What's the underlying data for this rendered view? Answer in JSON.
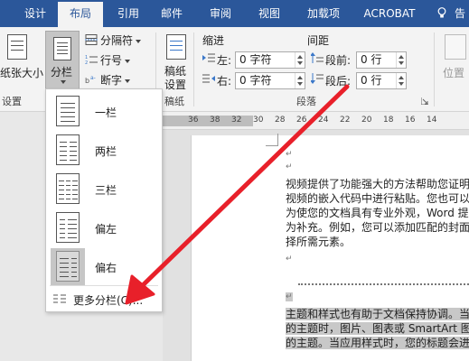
{
  "tabs": [
    "设计",
    "布局",
    "引用",
    "邮件",
    "审阅",
    "视图",
    "加载项",
    "ACROBAT",
    "告"
  ],
  "active_tab_index": 1,
  "ribbon": {
    "paper_size_label": "纸张大小",
    "columns_label": "分栏",
    "breaks_label": "分隔符",
    "line_numbers_label": "行号",
    "hyphenation_label": "断字",
    "setup_group_label": "设置",
    "draft_paper_label1": "稿纸",
    "draft_paper_label2": "设置",
    "draft_group_label": "稿纸",
    "indent_header": "缩进",
    "spacing_header": "间距",
    "indent_left_label": "左:",
    "indent_right_label": "右:",
    "indent_left_value": "0 字符",
    "indent_right_value": "0 字符",
    "spacing_before_label": "段前:",
    "spacing_after_label": "段后:",
    "spacing_before_value": "0 行",
    "spacing_after_value": "0 行",
    "paragraph_group_label": "段落",
    "position_label": "位置"
  },
  "ruler_numbers": [
    "36",
    "38",
    "32",
    "30",
    "28",
    "26",
    "24",
    "22",
    "20",
    "18",
    "16",
    "14"
  ],
  "columns_menu": {
    "items": [
      "一栏",
      "两栏",
      "三栏",
      "偏左",
      "偏右"
    ],
    "selected_index": 4,
    "more_label": "更多分栏(C)..."
  },
  "document": {
    "para1": [
      "视频提供了功能强大的方法帮助您证明",
      "视频的嵌入代码中进行粘贴。您也可以",
      "为使您的文档具有专业外观，Word 提",
      "为补充。例如，您可以添加匹配的封面",
      "择所需元素。"
    ],
    "para2": [
      "主题和样式也有助于文档保持协调。当",
      "的主题时，图片、图表或 SmartArt 图",
      "的主题。当应用样式时，您的标题会进"
    ]
  },
  "colors": {
    "tab_bar": "#2b579a",
    "ribbon_bg": "#f3f3f3",
    "annotation_arrow": "#e8202a"
  }
}
